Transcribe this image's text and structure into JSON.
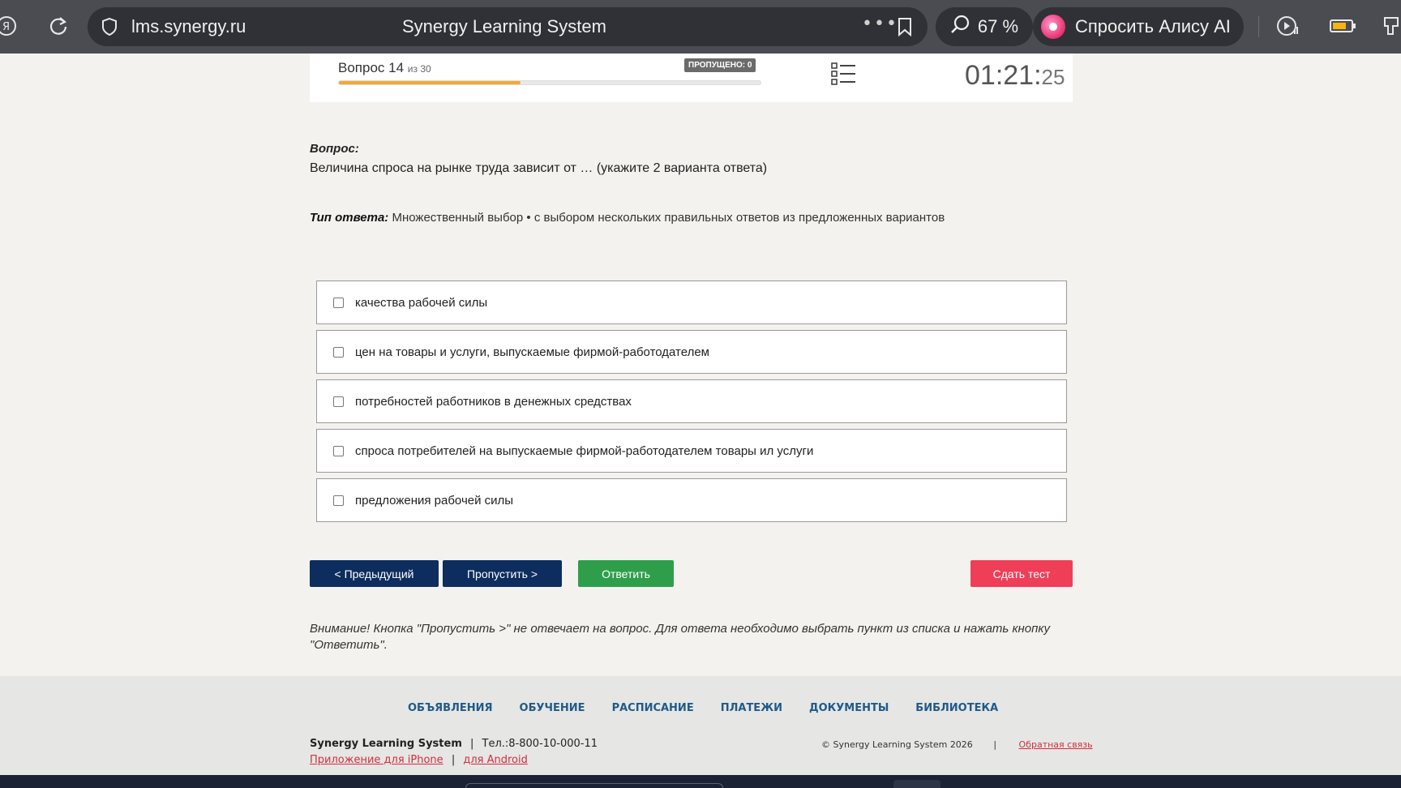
{
  "browser": {
    "url": "lms.synergy.ru",
    "title": "Synergy Learning System",
    "zoom": "67 %",
    "alice_label": "Спросить Алису AI"
  },
  "quiz": {
    "question_label": "Вопрос 14",
    "question_of": "из 30",
    "skipped_badge": "ПРОПУЩЕНО: 0",
    "progress": 0.43,
    "timer_main": "01:21:",
    "timer_sec": "25"
  },
  "question": {
    "label": "Вопрос:",
    "text": "Величина спроса на рынке труда зависит от … (укажите 2 варианта ответа)",
    "type_label": "Тип ответа:",
    "type_value": "Множественный выбор • с выбором нескольких правильных ответов из предложенных вариантов"
  },
  "options": [
    {
      "label": "качества рабочей силы"
    },
    {
      "label": "цен на товары и услуги, выпускаемые фирмой-работодателем"
    },
    {
      "label": "потребностей работников в денежных средствах"
    },
    {
      "label": "спроса потребителей на выпускаемые фирмой-работодателем товары ил услуги"
    },
    {
      "label": "предложения рабочей силы"
    }
  ],
  "buttons": {
    "prev": "< Предыдущий",
    "skip": "Пропустить >",
    "answer": "Ответить",
    "submit": "Сдать тест"
  },
  "warning": "Внимание! Кнопка \"Пропустить >\" не отвечает на вопрос. Для ответа необходимо выбрать пункт из списка и нажать кнопку \"Ответить\".",
  "footer": {
    "nav": [
      "ОБЪЯВЛЕНИЯ",
      "ОБУЧЕНИЕ",
      "РАСПИСАНИЕ",
      "ПЛАТЕЖИ",
      "ДОКУМЕНТЫ",
      "БИБЛИОТЕКА"
    ],
    "brand": "Synergy Learning System",
    "sep1": "|",
    "phone": "Тел.:8-800-10-000-11",
    "iphone_link": "Приложение для iPhone",
    "sep2": "|",
    "android_link": "для Android",
    "copyright": "© Synergy Learning System 2026",
    "sep3": "|",
    "feedback_link": "Обратная связь"
  },
  "colors": {
    "accent_dark": "#0d2d5e",
    "answer_green": "#2f9e4b",
    "submit_red": "#ef3e58",
    "progress_orange": "#f2a936"
  }
}
